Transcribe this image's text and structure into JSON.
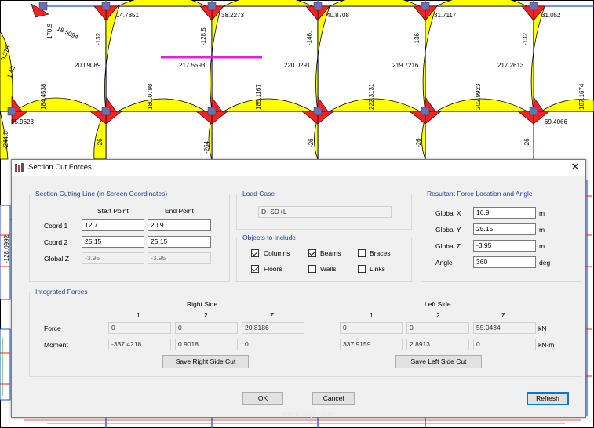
{
  "background": {
    "top_values": [
      "14.7851",
      "38.2273",
      "40.8708",
      "31.7117",
      "31.052",
      "18.5094",
      "170.9"
    ],
    "mid_values": [
      "200.9089",
      "217.5593",
      "220.0291",
      "219.7216",
      "217.2613",
      "0.375",
      "1.42"
    ],
    "vertical_upper": [
      "-132.",
      "-128.5",
      "-146.",
      "-136",
      "-132."
    ],
    "vertical_lower": [
      "184.4538",
      "180.0798",
      "185.1167",
      "222.3131",
      "202.9923",
      "187.1674"
    ],
    "row_values": [
      "85.9623",
      "-244.8",
      "69.4066"
    ],
    "vertical_bottom": [
      "-26",
      "-264",
      "-26",
      "-26",
      "-26"
    ],
    "left_values": [
      "-128.0992"
    ],
    "colors": {
      "frame": "#1a56c8",
      "positive": "#ffff00",
      "negative": "#ff2020",
      "cut_line": "#e020e0",
      "node": "#6f6fb0"
    }
  },
  "dialog": {
    "title": "Section Cut Forces",
    "close_icon": "✕",
    "cutting_line": {
      "title": "Section Cutting Line  (in Screen Coordinates)",
      "start_header": "Start Point",
      "end_header": "End Point",
      "coord1_label": "Coord 1",
      "coord1_start": "12.7",
      "coord1_end": "20.9",
      "coord2_label": "Coord 2",
      "coord2_start": "25.15",
      "coord2_end": "25.15",
      "globalz_label": "Global  Z",
      "globalz_start": "-3.95",
      "globalz_end": "-3.95"
    },
    "load_case": {
      "title": "Load Case",
      "value": "D+SD+L"
    },
    "objects": {
      "title": "Objects to Include",
      "columns": "Columns",
      "beams": "Beams",
      "braces": "Braces",
      "floors": "Floors",
      "walls": "Walls",
      "links": "Links"
    },
    "resultant": {
      "title": "Resultant Force Location and Angle",
      "gx_label": "Global  X",
      "gx_value": "16.9",
      "gx_unit": "m",
      "gy_label": "Global  Y",
      "gy_value": "25.15",
      "gy_unit": "m",
      "gz_label": "Global  Z",
      "gz_value": "-3.95",
      "gz_unit": "m",
      "angle_label": "Angle",
      "angle_value": "360",
      "angle_unit": "deg"
    },
    "integrated": {
      "title": "Integrated Forces",
      "right_side": "Right Side",
      "left_side": "Left Side",
      "col1": "1",
      "col2": "2",
      "colz": "Z",
      "force_label": "Force",
      "moment_label": "Moment",
      "right_force": [
        "0",
        "0",
        "20.8186"
      ],
      "right_moment": [
        "-337.4218",
        "0.9018",
        "0"
      ],
      "left_force": [
        "0",
        "0",
        "55.0434"
      ],
      "left_moment": [
        "337.9159",
        "2.8913",
        "0"
      ],
      "force_unit": "kN",
      "moment_unit": "kN-m",
      "save_right": "Save Right Side Cut",
      "save_left": "Save Left Side Cut"
    },
    "buttons": {
      "ok": "OK",
      "cancel": "Cancel",
      "refresh": "Refresh"
    },
    "watermark": "mostaql.com"
  }
}
